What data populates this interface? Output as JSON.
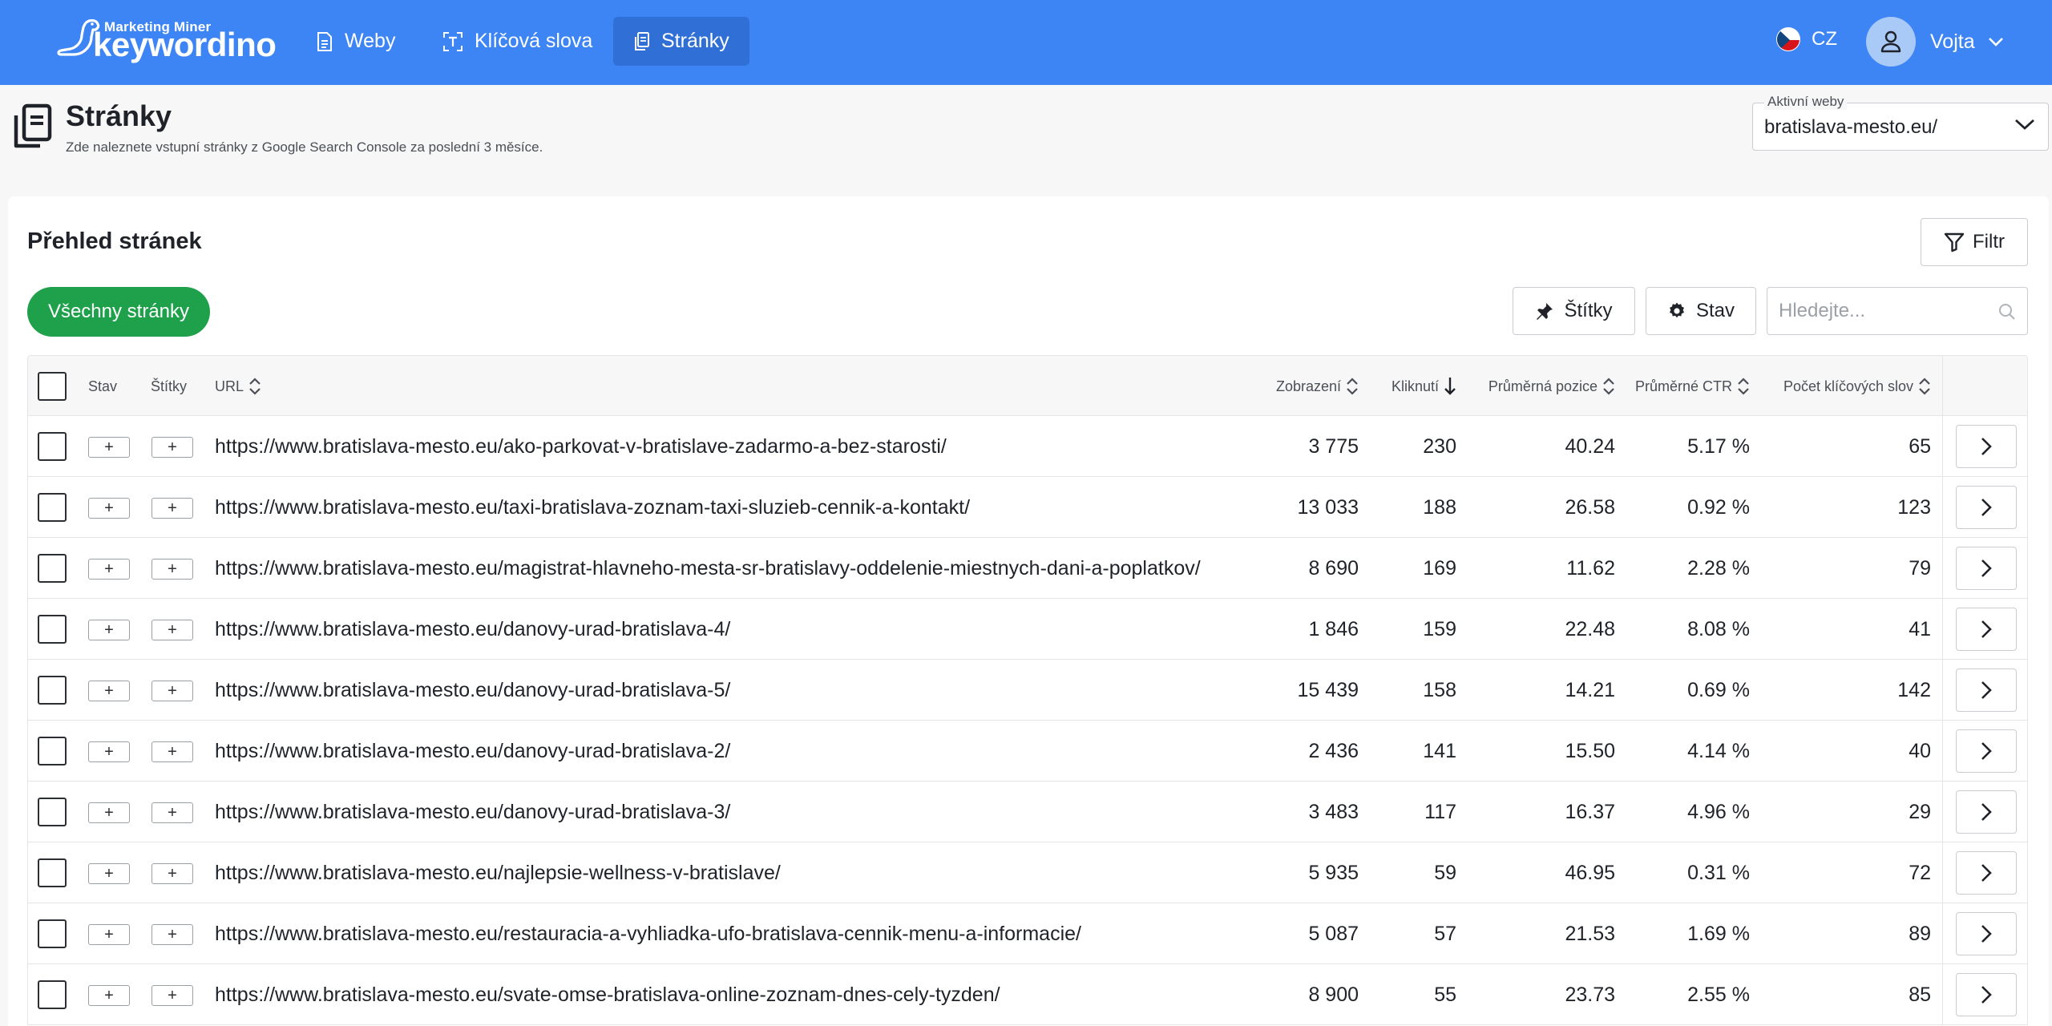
{
  "nav": {
    "brand_small": "Marketing Miner",
    "brand_big": "keywordino",
    "items": [
      {
        "label": "Weby",
        "icon": "document-icon"
      },
      {
        "label": "Klíčová slova",
        "icon": "text-box-icon"
      },
      {
        "label": "Stránky",
        "icon": "pages-icon",
        "active": true
      }
    ],
    "language": "CZ",
    "user_name": "Vojta"
  },
  "header": {
    "title": "Stránky",
    "subtitle": "Zde naleznete vstupní stránky z Google Search Console za poslední 3 měsíce.",
    "active_web_label": "Aktivní weby",
    "active_web_value": "bratislava-mesto.eu/"
  },
  "card": {
    "title": "Přehled stránek",
    "filter_label": "Filtr",
    "all_pages_label": "Všechny stránky",
    "tags_button_label": "Štítky",
    "status_button_label": "Stav",
    "search_placeholder": "Hledejte..."
  },
  "table": {
    "columns": {
      "status": "Stav",
      "tags": "Štítky",
      "url": "URL",
      "impressions": "Zobrazení",
      "clicks": "Kliknutí",
      "avg_position": "Průměrná pozice",
      "avg_ctr": "Průměrné CTR",
      "keyword_count": "Počet klíčových slov"
    },
    "plus_label": "+",
    "rows": [
      {
        "url": "https://www.bratislava-mesto.eu/ako-parkovat-v-bratislave-zadarmo-a-bez-starosti/",
        "impressions": "3 775",
        "clicks": "230",
        "position": "40.24",
        "ctr": "5.17 %",
        "keywords": "65"
      },
      {
        "url": "https://www.bratislava-mesto.eu/taxi-bratislava-zoznam-taxi-sluzieb-cennik-a-kontakt/",
        "impressions": "13 033",
        "clicks": "188",
        "position": "26.58",
        "ctr": "0.92 %",
        "keywords": "123"
      },
      {
        "url": "https://www.bratislava-mesto.eu/magistrat-hlavneho-mesta-sr-bratislavy-oddelenie-miestnych-dani-a-poplatkov/",
        "impressions": "8 690",
        "clicks": "169",
        "position": "11.62",
        "ctr": "2.28 %",
        "keywords": "79"
      },
      {
        "url": "https://www.bratislava-mesto.eu/danovy-urad-bratislava-4/",
        "impressions": "1 846",
        "clicks": "159",
        "position": "22.48",
        "ctr": "8.08 %",
        "keywords": "41"
      },
      {
        "url": "https://www.bratislava-mesto.eu/danovy-urad-bratislava-5/",
        "impressions": "15 439",
        "clicks": "158",
        "position": "14.21",
        "ctr": "0.69 %",
        "keywords": "142"
      },
      {
        "url": "https://www.bratislava-mesto.eu/danovy-urad-bratislava-2/",
        "impressions": "2 436",
        "clicks": "141",
        "position": "15.50",
        "ctr": "4.14 %",
        "keywords": "40"
      },
      {
        "url": "https://www.bratislava-mesto.eu/danovy-urad-bratislava-3/",
        "impressions": "3 483",
        "clicks": "117",
        "position": "16.37",
        "ctr": "4.96 %",
        "keywords": "29"
      },
      {
        "url": "https://www.bratislava-mesto.eu/najlepsie-wellness-v-bratislave/",
        "impressions": "5 935",
        "clicks": "59",
        "position": "46.95",
        "ctr": "0.31 %",
        "keywords": "72"
      },
      {
        "url": "https://www.bratislava-mesto.eu/restauracia-a-vyhliadka-ufo-bratislava-cennik-menu-a-informacie/",
        "impressions": "5 087",
        "clicks": "57",
        "position": "21.53",
        "ctr": "1.69 %",
        "keywords": "89"
      },
      {
        "url": "https://www.bratislava-mesto.eu/svate-omse-bratislava-online-zoznam-dnes-cely-tyzden/",
        "impressions": "8 900",
        "clicks": "55",
        "position": "23.73",
        "ctr": "2.55 %",
        "keywords": "85"
      }
    ]
  },
  "colors": {
    "navbar": "#3d85f5",
    "navbar_active": "#2f6fd6",
    "primary_green": "#1ea14a"
  }
}
